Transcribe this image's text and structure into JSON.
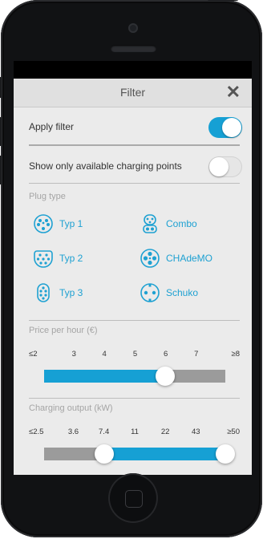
{
  "header": {
    "title": "Filter",
    "close_icon": "close-icon"
  },
  "apply_filter": {
    "label": "Apply filter",
    "enabled": true
  },
  "available_only": {
    "label": "Show only available charging points",
    "enabled": false
  },
  "plug_type": {
    "label": "Plug type",
    "items": [
      {
        "label": "Typ 1",
        "icon": "typ1-plug-icon"
      },
      {
        "label": "Combo",
        "icon": "combo-plug-icon"
      },
      {
        "label": "Typ 2",
        "icon": "typ2-plug-icon"
      },
      {
        "label": "CHAdeMO",
        "icon": "chademo-plug-icon"
      },
      {
        "label": "Typ 3",
        "icon": "typ3-plug-icon"
      },
      {
        "label": "Schuko",
        "icon": "schuko-plug-icon"
      }
    ]
  },
  "price": {
    "label": "Price per hour (€)",
    "ticks": [
      "≤2",
      "3",
      "4",
      "5",
      "6",
      "7",
      "≥8"
    ],
    "selected_max": "6"
  },
  "output": {
    "label": "Charging output (kW)",
    "ticks": [
      "≤2.5",
      "3.6",
      "7.4",
      "11",
      "22",
      "43",
      "≥50"
    ],
    "selected_min": "7.4",
    "selected_max": "≥50"
  },
  "colors": {
    "accent": "#16a0d4",
    "track": "#9b9b9b",
    "text": "#333333",
    "muted": "#a5a5a5"
  }
}
